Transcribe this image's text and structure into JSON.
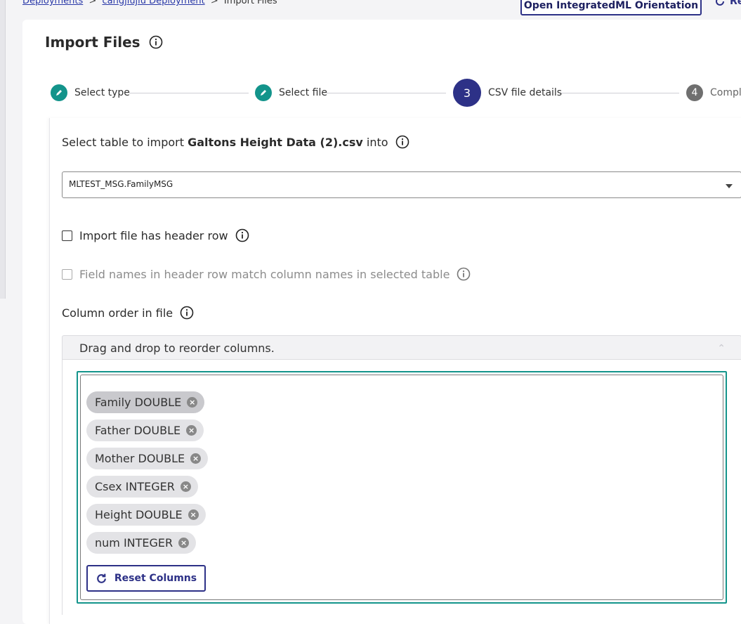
{
  "breadcrumb": {
    "items": [
      "Deployments",
      "cangjiujiu Deployment"
    ],
    "current": "Import Files",
    "separator": ">"
  },
  "header": {
    "orientation_button": "Open IntegratedML Orientation",
    "refresh_label": "Re"
  },
  "page": {
    "title": "Import Files"
  },
  "stepper": {
    "steps": [
      {
        "label": "Select type",
        "state": "done"
      },
      {
        "label": "Select file",
        "state": "done"
      },
      {
        "label": "CSV file details",
        "state": "active",
        "number": "3"
      },
      {
        "label": "Comple",
        "state": "pending",
        "number": "4"
      }
    ]
  },
  "form": {
    "select_prefix": "Select table to import",
    "file_name": "Galtons Height Data (2).csv",
    "select_suffix": "into",
    "table_value": "MLTEST_MSG.FamilyMSG",
    "header_row_label": "Import file has header row",
    "header_row_checked": false,
    "match_names_label": "Field names in header row match column names in selected table",
    "match_names_disabled": true,
    "column_order_label": "Column order in file",
    "accordion_label": "Drag and drop to reorder columns.",
    "columns": [
      {
        "label": "Family DOUBLE",
        "selected": true
      },
      {
        "label": "Father DOUBLE",
        "selected": false
      },
      {
        "label": "Mother DOUBLE",
        "selected": false
      },
      {
        "label": "Csex INTEGER",
        "selected": false
      },
      {
        "label": "Height DOUBLE",
        "selected": false
      },
      {
        "label": "num INTEGER",
        "selected": false
      }
    ],
    "reset_button": "Reset Columns"
  },
  "colors": {
    "primary": "#2d3187",
    "teal": "#13948b",
    "link": "#2a39a8"
  }
}
